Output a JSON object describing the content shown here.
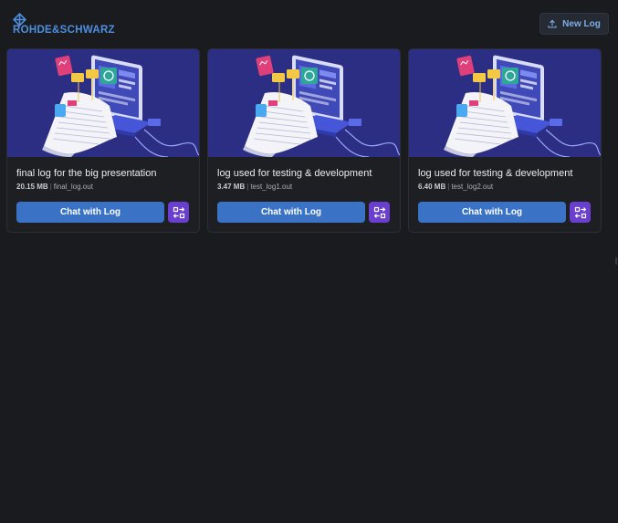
{
  "brand": {
    "name": "ROHDE&SCHWARZ",
    "logo_icon": "rohde-schwarz-diamond-icon"
  },
  "header": {
    "new_log_label": "New Log",
    "new_log_icon": "upload-icon"
  },
  "colors": {
    "background": "#1a1b1e",
    "card": "#1e1f23",
    "brand_blue": "#4e8fe0",
    "chat_button": "#3a73c5",
    "swap_button": "#6a3fd0",
    "illustration_bg": "#2b2e82"
  },
  "logs": [
    {
      "title": "final log for the big presentation",
      "size": "20.15 MB",
      "filename": "final_log.out",
      "chat_label": "Chat with Log",
      "swap_icon": "switch-icon"
    },
    {
      "title": "log used for testing & development",
      "size": "3.47 MB",
      "filename": "test_log1.out",
      "chat_label": "Chat with Log",
      "swap_icon": "switch-icon"
    },
    {
      "title": "log used for testing & development",
      "size": "6.40 MB",
      "filename": "test_log2.out",
      "chat_label": "Chat with Log",
      "swap_icon": "switch-icon"
    }
  ]
}
